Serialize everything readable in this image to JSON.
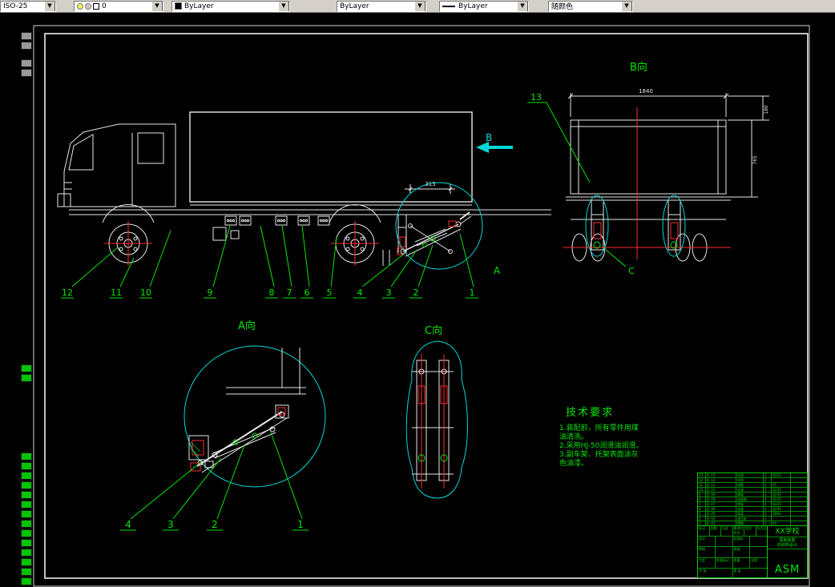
{
  "toolbar": {
    "style_combo": "ISO-25",
    "layer_value": "0",
    "color_value": "ByLayer",
    "linetype_value": "ByLayer",
    "lineweight_value": "ByLayer",
    "plotstyle_value": "随颜色"
  },
  "drawing": {
    "view_labels": {
      "a": "A向",
      "b": "B向",
      "c": "C向"
    },
    "b_arrow_label": "B",
    "a_label": "A",
    "c_label": "C",
    "main_callouts": [
      "12",
      "11",
      "10",
      "9",
      "8",
      "7",
      "6",
      "5",
      "4",
      "3",
      "2",
      "1"
    ],
    "b_callout": "13",
    "a_callouts": [
      "4",
      "3",
      "2",
      "1"
    ],
    "dims": {
      "width_top": "1840",
      "height_right": "765",
      "height_small": "180",
      "rear_offset": "315"
    }
  },
  "tech_requirements": {
    "title": "技术要求",
    "lines": [
      "1.装配前，所有零件用煤",
      "油清洗。",
      "2.采用HJ-50润滑油润滑。",
      "3.副车架、托架表面涂灰",
      "色油漆。"
    ]
  },
  "title_block": {
    "school": "XX学校",
    "project_line1": "尾板装置",
    "project_line2": "的结构设计",
    "drawing_no": "ASM",
    "labels": {
      "mark": "标记",
      "count": "处数",
      "zone": "分区",
      "file": "更改文件号",
      "sign": "签名",
      "date": "年月日",
      "design": "设计",
      "check": "审核",
      "process": "工艺",
      "standardize": "标准化",
      "approve": "批准",
      "stage": "阶段标记",
      "mass": "质量",
      "scale": "比例",
      "sheets": "共 张",
      "page": "第 张"
    },
    "bom": [
      {
        "no": "13",
        "code": "JC-13",
        "name": "托架",
        "qty": "1",
        "mat": "Q235",
        "rem": ""
      },
      {
        "no": "12",
        "code": "JC-12",
        "name": "车轮",
        "qty": "2",
        "mat": "",
        "rem": ""
      },
      {
        "no": "11",
        "code": "JC-11",
        "name": "轮毂",
        "qty": "2",
        "mat": "45",
        "rem": ""
      },
      {
        "no": "10",
        "code": "JC-10",
        "name": "支座",
        "qty": "2",
        "mat": "Q235",
        "rem": ""
      },
      {
        "no": "9",
        "code": "JC-09",
        "name": "横梁",
        "qty": "2",
        "mat": "Q235",
        "rem": ""
      },
      {
        "no": "8",
        "code": "JC-08",
        "name": "连接板",
        "qty": "4",
        "mat": "Q235",
        "rem": ""
      },
      {
        "no": "7",
        "code": "JC-07",
        "name": "垫板",
        "qty": "4",
        "mat": "Q235",
        "rem": ""
      },
      {
        "no": "6",
        "code": "JC-06",
        "name": "支架",
        "qty": "2",
        "mat": "Q235",
        "rem": ""
      },
      {
        "no": "5",
        "code": "JC-05",
        "name": "纵梁",
        "qty": "2",
        "mat": "16Mn",
        "rem": ""
      },
      {
        "no": "4",
        "code": "JC-04",
        "name": "液压缸",
        "qty": "2",
        "mat": "",
        "rem": ""
      },
      {
        "no": "3",
        "code": "JC-03",
        "name": "摆臂",
        "qty": "2",
        "mat": "45",
        "rem": ""
      },
      {
        "no": "2",
        "code": "JC-02",
        "name": "连杆",
        "qty": "2",
        "mat": "45",
        "rem": ""
      },
      {
        "no": "1",
        "code": "JC-01",
        "name": "托板",
        "qty": "1",
        "mat": "Q235",
        "rem": ""
      }
    ]
  }
}
